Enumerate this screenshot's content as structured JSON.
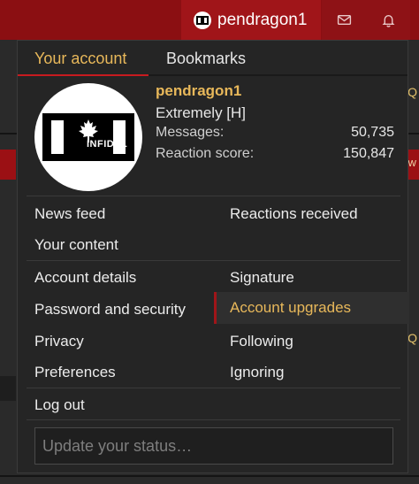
{
  "header": {
    "username": "pendragon1",
    "messages_icon": "envelope-icon",
    "alerts_icon": "bell-icon"
  },
  "background": {
    "q_glyph": "Q",
    "w_glyph": "W"
  },
  "tabs": [
    {
      "label": "Your account",
      "active": true
    },
    {
      "label": "Bookmarks",
      "active": false
    }
  ],
  "profile": {
    "name": "pendragon1",
    "title": "Extremely [H]",
    "avatar_text": "INFIDEL",
    "stats": [
      {
        "label": "Messages:",
        "value": "50,735"
      },
      {
        "label": "Reaction score:",
        "value": "150,847"
      }
    ]
  },
  "menu": {
    "news_feed": "News feed",
    "reactions_received": "Reactions received",
    "your_content": "Your content",
    "account_details": "Account details",
    "signature": "Signature",
    "password_security": "Password and security",
    "account_upgrades": "Account upgrades",
    "privacy": "Privacy",
    "following": "Following",
    "preferences": "Preferences",
    "ignoring": "Ignoring",
    "log_out": "Log out"
  },
  "status": {
    "placeholder": "Update your status…"
  },
  "colors": {
    "accent": "#e8b85a",
    "brand_red": "#a01519",
    "menu_bg": "#252525"
  }
}
